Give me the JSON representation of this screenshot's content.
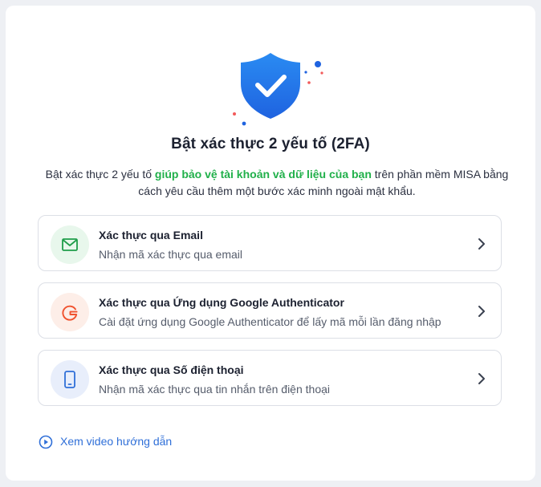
{
  "header": {
    "title": "Bật xác thực 2 yếu tố (2FA)",
    "desc_part1": "Bật xác thực 2 yếu tố ",
    "desc_highlight": "giúp bảo vệ tài khoản và dữ liệu của bạn",
    "desc_part2": " trên phần mềm MISA bằng cách yêu cầu thêm một bước xác minh ngoài mật khẩu."
  },
  "options": [
    {
      "title": "Xác thực qua Email",
      "subtitle": "Nhận mã xác thực qua email",
      "icon": "mail-icon"
    },
    {
      "title": "Xác thực qua Ứng dụng Google Authenticator",
      "subtitle": "Cài đặt ứng dụng Google Authenticator để lấy mã mỗi lần đăng nhập",
      "icon": "google-icon"
    },
    {
      "title": "Xác thực qua Số điện thoại",
      "subtitle": "Nhận mã xác thực qua tin nhắn trên điện thoại",
      "icon": "phone-icon"
    }
  ],
  "footer": {
    "video_label": "Xem video hướng dẫn"
  },
  "colors": {
    "accent_blue": "#2f6fd8",
    "highlight_green": "#20b04a",
    "email_bg": "#e8f7ec",
    "google_bg": "#fdeee8",
    "phone_bg": "#e8eefb"
  }
}
